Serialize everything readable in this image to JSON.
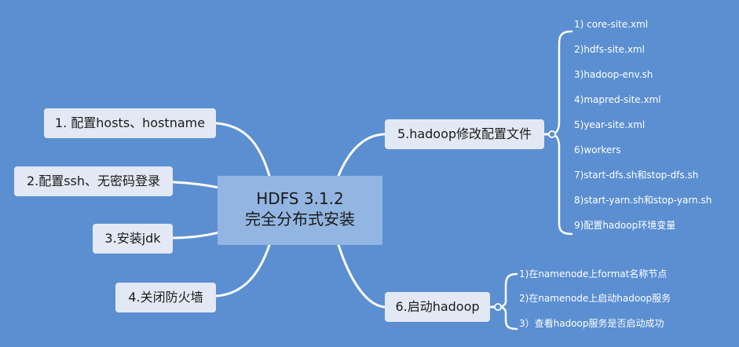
{
  "center": {
    "line1": "HDFS 3.1.2",
    "line2": "完全分布式安装"
  },
  "left_nodes": [
    "1. 配置hosts、hostname",
    "2.配置ssh、无密码登录",
    "3.安装jdk",
    "4.关闭防火墙"
  ],
  "right_nodes": {
    "config": {
      "label": "5.hadoop修改配置文件",
      "children": [
        "1) core-site.xml",
        "2)hdfs-site.xml",
        "3)hadoop-env.sh",
        "4)mapred-site.xml",
        "5)year-site.xml",
        "6)workers",
        "7)start-dfs.sh和stop-dfs.sh",
        "8)start-yarn.sh和stop-yarn.sh",
        "9)配置hadoop环境变量"
      ]
    },
    "start": {
      "label": "6.启动hadoop",
      "children": [
        "1)在namenode上format名称节点",
        "2)在namenode上启动hadoop服务",
        "3）查看hadoop服务是否启动成功"
      ]
    }
  }
}
